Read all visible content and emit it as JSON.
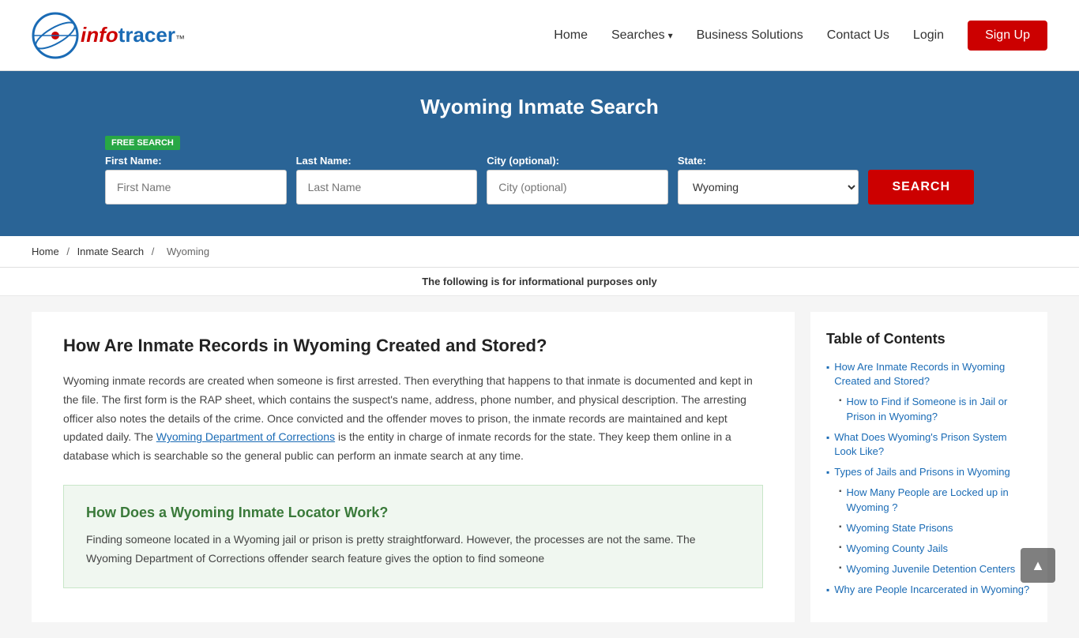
{
  "header": {
    "logo_info": "info",
    "logo_tracer": "tracer",
    "logo_tm": "™",
    "nav": {
      "home": "Home",
      "searches": "Searches",
      "business_solutions": "Business Solutions",
      "contact_us": "Contact Us",
      "login": "Login",
      "signup": "Sign Up"
    }
  },
  "search_section": {
    "title": "Wyoming Inmate Search",
    "free_badge": "FREE SEARCH",
    "fields": {
      "first_name_label": "First Name:",
      "first_name_placeholder": "First Name",
      "last_name_label": "Last Name:",
      "last_name_placeholder": "Last Name",
      "city_label": "City (optional):",
      "city_placeholder": "City (optional)",
      "state_label": "State:",
      "state_value": "Wyoming"
    },
    "search_button": "SEARCH"
  },
  "breadcrumb": {
    "home": "Home",
    "inmate_search": "Inmate Search",
    "wyoming": "Wyoming",
    "sep": "/"
  },
  "info_bar": {
    "text": "The following is for informational purposes only"
  },
  "article": {
    "heading": "How Are Inmate Records in Wyoming Created and Stored?",
    "body": "Wyoming inmate records are created when someone is first arrested. Then everything that happens to that inmate is documented and kept in the file. The first form is the RAP sheet, which contains the suspect's name, address, phone number, and physical description. The arresting officer also notes the details of the crime. Once convicted and the offender moves to prison, the inmate records are maintained and kept updated daily. The ",
    "link_text": "Wyoming Department of Corrections",
    "body2": " is the entity in charge of inmate records for the state. They keep them online in a database which is searchable so the general public can perform an inmate search at any time.",
    "green_box": {
      "heading": "How Does a Wyoming Inmate Locator Work?",
      "body": "Finding someone located in a Wyoming jail or prison is pretty straightforward. However, the processes are not the same. The Wyoming Department of Corrections offender search feature gives the option to find someone"
    }
  },
  "toc": {
    "heading": "Table of Contents",
    "items": [
      {
        "label": "How Are Inmate Records in Wyoming Created and Stored?",
        "sub": false
      },
      {
        "label": "How to Find if Someone is in Jail or Prison in Wyoming?",
        "sub": true
      },
      {
        "label": "What Does Wyoming's Prison System Look Like?",
        "sub": false
      },
      {
        "label": "Types of Jails and Prisons in Wyoming",
        "sub": false
      },
      {
        "label": "How Many People are Locked up in Wyoming ?",
        "sub": true
      },
      {
        "label": "Wyoming State Prisons",
        "sub": true
      },
      {
        "label": "Wyoming County Jails",
        "sub": true
      },
      {
        "label": "Wyoming Juvenile Detention Centers",
        "sub": true
      },
      {
        "label": "Why are People Incarcerated in Wyoming?",
        "sub": false
      }
    ]
  },
  "scroll_top": {
    "icon": "▲"
  }
}
